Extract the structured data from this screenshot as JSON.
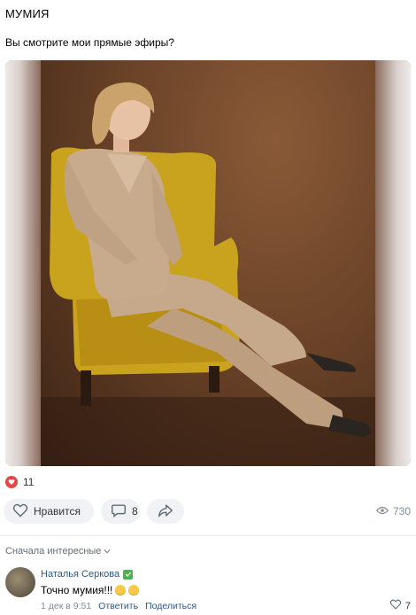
{
  "post": {
    "title": "МУМИЯ",
    "text": "Вы смотрите мои прямые эфиры?",
    "likes_count": "11",
    "like_label": "Нравится",
    "comments_count": "8",
    "views_count": "730"
  },
  "comments": {
    "sort_label": "Сначала интересные",
    "items": [
      {
        "author": "Наталья Серкова",
        "text": "Точно мумия!!!",
        "emoji": [
          "😜",
          "😜"
        ],
        "time": "1 дек в 9:51",
        "reply_label": "Ответить",
        "share_label": "Поделиться",
        "likes": "7"
      }
    ]
  },
  "colors": {
    "accent": "#2a5885",
    "like_red": "#e64646",
    "button_bg": "#f0f2f5",
    "muted": "#818c99",
    "verified": "#4bb34b"
  }
}
